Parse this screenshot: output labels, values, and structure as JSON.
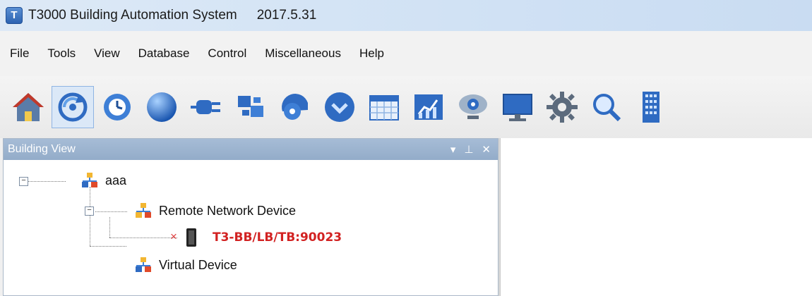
{
  "window": {
    "title": "T3000 Building Automation System",
    "version": "2017.5.31",
    "app_icon": "T"
  },
  "menu": [
    "File",
    "Tools",
    "View",
    "Database",
    "Control",
    "Miscellaneous",
    "Help"
  ],
  "toolbar": {
    "icons": [
      "home-icon",
      "network-scan-icon",
      "schedule-clock-icon",
      "sphere-icon",
      "plug-icon",
      "connection-icon",
      "fan-icon",
      "dial-icon",
      "calendar-icon",
      "trend-chart-icon",
      "webcam-icon",
      "monitor-icon",
      "gear-icon",
      "search-icon",
      "building-icon"
    ],
    "active_index": 1
  },
  "panel": {
    "title": "Building View",
    "controls": {
      "menu": "▾",
      "pin": "⊥",
      "close": "✕"
    }
  },
  "tree": {
    "root": {
      "label": "aaa",
      "expander": "−"
    },
    "remote": {
      "label": "Remote Network Device",
      "expander": "−"
    },
    "device": {
      "label": "T3-BB/LB/TB:90023",
      "status": "×"
    },
    "virtual": {
      "label": "Virtual Device"
    }
  },
  "colors": {
    "titlebar": "#d4e4f5",
    "panel_header": "#9db3cf",
    "device_red": "#d22222",
    "accent_blue": "#1f63b8"
  }
}
